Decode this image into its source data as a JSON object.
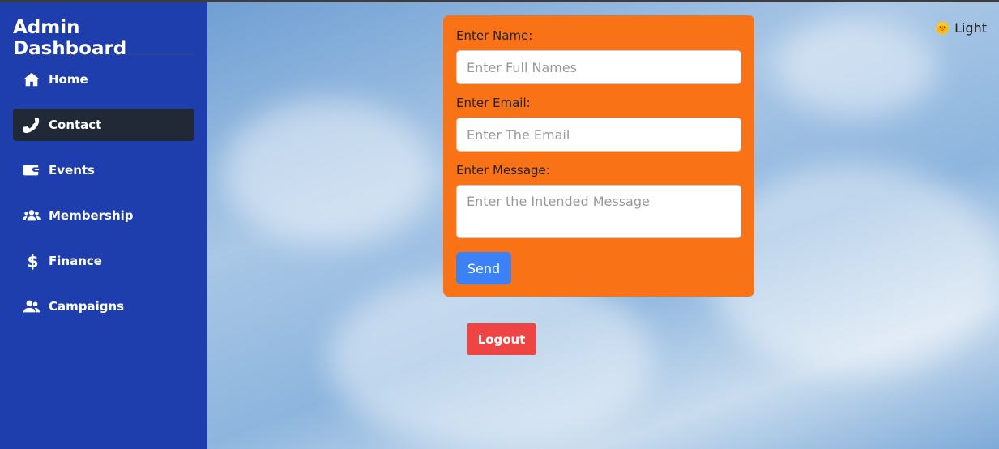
{
  "sidebar": {
    "title": "Admin Dashboard",
    "items": [
      {
        "label": "Home",
        "icon": "home-icon"
      },
      {
        "label": "Contact",
        "icon": "phone-icon",
        "active": true
      },
      {
        "label": "Events",
        "icon": "wallet-icon"
      },
      {
        "label": "Membership",
        "icon": "users-icon"
      },
      {
        "label": "Finance",
        "icon": "dollar-icon"
      },
      {
        "label": "Campaigns",
        "icon": "user-group-icon"
      }
    ]
  },
  "theme": {
    "icon": "sun-icon",
    "label": "Light"
  },
  "form": {
    "name_label": "Enter Name:",
    "name_placeholder": "Enter Full Names",
    "email_label": "Enter Email:",
    "email_placeholder": "Enter The Email",
    "message_label": "Enter Message:",
    "message_placeholder": "Enter the Intended Message",
    "send_label": "Send"
  },
  "logout_label": "Logout",
  "colors": {
    "sidebar": "#1e3ead",
    "active": "#212936",
    "form": "#f97316",
    "send": "#3b82f6",
    "logout": "#ef4444"
  }
}
